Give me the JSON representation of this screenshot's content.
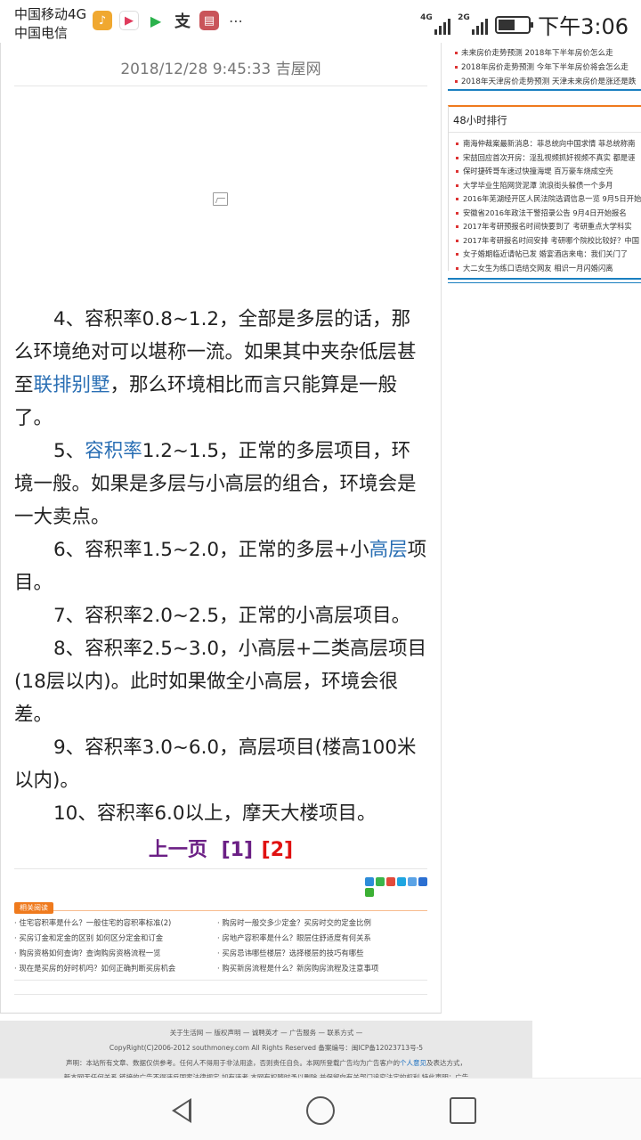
{
  "status_bar": {
    "carrier1": "中国移动4G",
    "carrier2": "中国电信",
    "signal1_label": "4G",
    "signal2_label": "2G",
    "battery_level": 0.55,
    "time": "下午3:06"
  },
  "article": {
    "title_fragment": "（ ）",
    "meta": "2018/12/28 9:45:33 吉屋网",
    "p4a": "4、容积率0.8~1.2，全部是多层的话，那么环境绝对可以堪称一流。如果其中夹杂低层甚至",
    "p4_link": "联排别墅",
    "p4b": "，那么环境相比而言只能算是一般了。",
    "p5_num": "5、",
    "p5_link": "容积率",
    "p5b": "1.2~1.5，正常的多层项目，环境一般。如果是多层与小高层的组合，环境会是一大卖点。",
    "p6a": "6、容积率1.5~2.0，正常的多层+小",
    "p6_link": "高层",
    "p6b": "项目。",
    "p7": "7、容积率2.0~2.5，正常的小高层项目。",
    "p8": "8、容积率2.5~3.0，小高层+二类高层项目(18层以内)。此时如果做全小高层，环境会很差。",
    "p9": "9、容积率3.0~6.0，高层项目(楼高100米以内)。",
    "p10": "10、容积率6.0以上，摩天大楼项目。"
  },
  "pager": {
    "prev": "上一页",
    "page1": "[1]",
    "page2": "[2]"
  },
  "related": {
    "tag": "相关阅读",
    "items": [
      "· 住宅容积率是什么？一般住宅的容积率标准(2)",
      "· 购房时一般交多少定金？买房时交的定金比例",
      "· 买房订金和定金的区别 如何区分定金和订金",
      "· 房地产容积率是什么？眼层住舒适度有何关系",
      "· 购房资格如何查询？查询购房资格流程一览",
      "· 买房忌讳哪些楼层？选择楼层的技巧有哪些",
      "· 现在是买房的好时机吗？如何正确判断买房机会",
      "· 购买新房流程是什么？新房购房流程及注意事项"
    ]
  },
  "sidebar": {
    "top_items": [
      "未来房价走势预测 2018年下半年房价怎么走",
      "2018年房价走势预测 今年下半年房价将会怎么走",
      "2018年天津房价走势预测 天津未来房价是涨还是跌"
    ],
    "rank_title": "48小时排行",
    "rank_items": [
      "南海仲裁案最新消息：菲总统向中国求情 菲总统称南",
      "宋喆回应首次开房：淫乱视频抓奸视频不真实 都是诬",
      "保时捷砖哥车速过快撞海堤 百万豪车烧成空壳",
      "大学毕业生陷网贷泥潭 流浪街头躲债一个多月",
      "2016年芜湖经开区人民法院选调信息一览 9月5日开始",
      "安徽省2016年政法干警招录公告 9月4日开始报名",
      "2017年考研预报名时间快要到了 考研重点大学科实",
      "2017年考研报名时间安排 考研哪个院校比较好？中国",
      "女子婚期临近请帖已发 婚宴酒店来电：我们关门了",
      "大二女生为练口语结交网友 相识一月闪婚闪离"
    ]
  },
  "footer": {
    "links": "关于生活网 — 版权声明 — 诚聘英才 — 广告服务 — 联系方式 —",
    "copyright": "CopyRight(C)2006-2012 southmoney.com All Rights Reserved 备案编号：闽ICP备12023713号-5",
    "statement_a": "声明：本站所有文章、数据仅供参考。任何人不得用于非法用途，否则责任自负。本网所登载广告均为广告客户的",
    "statement_link": "个人意见",
    "statement_b": "及表达方式，",
    "cutoff": "新本网无任何关系    链接的广告不得违反国家法律规定    如有违者    本网有权随时予以删除    并保留向有关部门追究法定的权利    特此声明：广告"
  },
  "colors": {
    "link_blue": "#2a6fb4",
    "pager_purple": "#6b1f85",
    "pager_red": "#e01010",
    "sidebar_blue": "#1a7fc0",
    "accent_orange": "#ef7a1d"
  }
}
